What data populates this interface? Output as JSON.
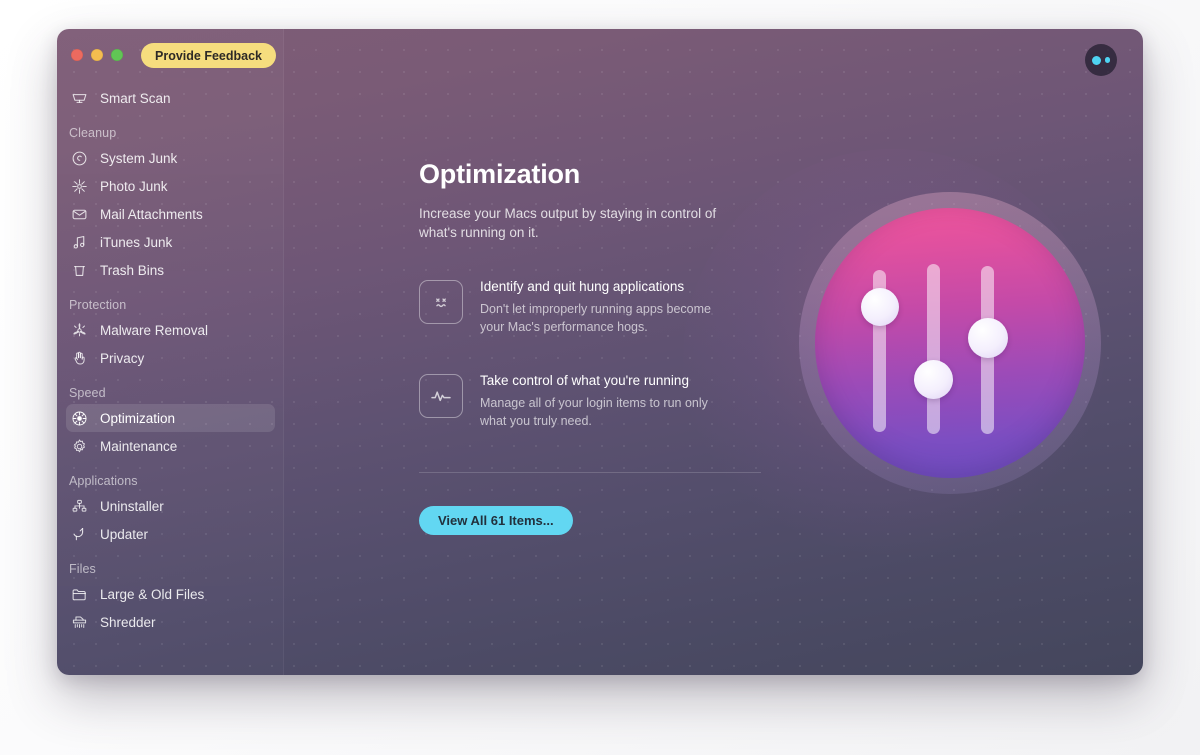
{
  "window": {
    "traffic_lights": [
      "close",
      "minimize",
      "zoom"
    ],
    "feedback_button": "Provide Feedback"
  },
  "colors": {
    "accent_button": "#62d7f2",
    "feedback_button": "#f6dd7e",
    "badge_dot": "#4fd3f2",
    "selected_row": "rgba(255,255,255,0.115)",
    "artwork_gradient_start": "#f0569c",
    "artwork_gradient_end": "#6f4fc4"
  },
  "sidebar": {
    "groups": [
      {
        "label": "",
        "items": [
          {
            "label": "Smart Scan",
            "icon": "monitor-icon",
            "selected": false
          }
        ]
      },
      {
        "label": "Cleanup",
        "items": [
          {
            "label": "System Junk",
            "icon": "system-junk-icon",
            "selected": false
          },
          {
            "label": "Photo Junk",
            "icon": "photo-junk-icon",
            "selected": false
          },
          {
            "label": "Mail Attachments",
            "icon": "envelope-icon",
            "selected": false
          },
          {
            "label": "iTunes Junk",
            "icon": "music-note-icon",
            "selected": false
          },
          {
            "label": "Trash Bins",
            "icon": "trash-icon",
            "selected": false
          }
        ]
      },
      {
        "label": "Protection",
        "items": [
          {
            "label": "Malware Removal",
            "icon": "biohazard-icon",
            "selected": false
          },
          {
            "label": "Privacy",
            "icon": "hand-icon",
            "selected": false
          }
        ]
      },
      {
        "label": "Speed",
        "items": [
          {
            "label": "Optimization",
            "icon": "starburst-icon",
            "selected": true
          },
          {
            "label": "Maintenance",
            "icon": "gear-icon",
            "selected": false
          }
        ]
      },
      {
        "label": "Applications",
        "items": [
          {
            "label": "Uninstaller",
            "icon": "org-chart-icon",
            "selected": false
          },
          {
            "label": "Updater",
            "icon": "refresh-arrow-icon",
            "selected": false
          }
        ]
      },
      {
        "label": "Files",
        "items": [
          {
            "label": "Large & Old Files",
            "icon": "folder-icon",
            "selected": false
          },
          {
            "label": "Shredder",
            "icon": "shredder-icon",
            "selected": false
          }
        ]
      }
    ]
  },
  "main": {
    "title": "Optimization",
    "subtitle": "Increase your Macs output by staying in control of what's running on it.",
    "features": [
      {
        "icon": "dead-face-icon",
        "title": "Identify and quit hung applications",
        "description": "Don't let improperly running apps become your Mac's performance hogs."
      },
      {
        "icon": "activity-pulse-icon",
        "title": "Take control of what you're running",
        "description": "Manage all of your login items to run only what you truly need."
      }
    ],
    "view_all_button": "View All 61 Items...",
    "status_badge": {
      "icon": "two-dots-icon"
    },
    "artwork": {
      "icon": "sliders-icon",
      "sliders": [
        {
          "knob_position": "upper"
        },
        {
          "knob_position": "lower"
        },
        {
          "knob_position": "middle"
        }
      ]
    }
  }
}
